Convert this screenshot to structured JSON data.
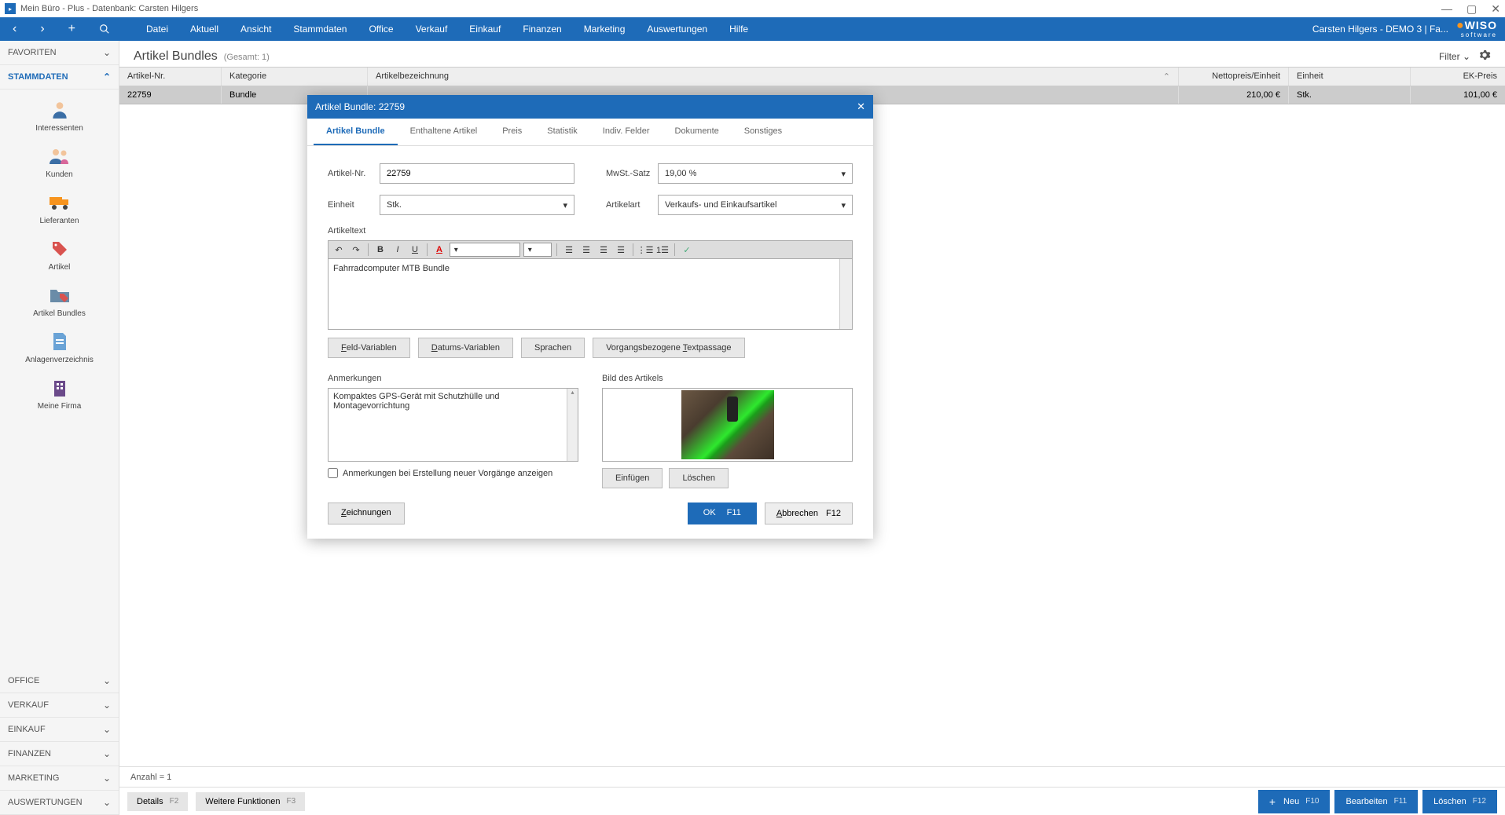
{
  "titlebar": {
    "text": "Mein Büro - Plus - Datenbank: Carsten Hilgers"
  },
  "toolbar": {
    "menu": [
      "Datei",
      "Aktuell",
      "Ansicht",
      "Stammdaten",
      "Office",
      "Verkauf",
      "Einkauf",
      "Finanzen",
      "Marketing",
      "Auswertungen",
      "Hilfe"
    ],
    "user": "Carsten Hilgers - DEMO 3 | Fa...",
    "brand": "WISO",
    "brand_sub": "software"
  },
  "sidebar": {
    "favoriten": "FAVORITEN",
    "stammdaten": "STAMMDATEN",
    "items": [
      {
        "label": "Interessenten"
      },
      {
        "label": "Kunden"
      },
      {
        "label": "Lieferanten"
      },
      {
        "label": "Artikel"
      },
      {
        "label": "Artikel Bundles"
      },
      {
        "label": "Anlagenverzeichnis"
      },
      {
        "label": "Meine Firma"
      }
    ],
    "bottom": [
      "OFFICE",
      "VERKAUF",
      "EINKAUF",
      "FINANZEN",
      "MARKETING",
      "AUSWERTUNGEN"
    ]
  },
  "content": {
    "title": "Artikel Bundles",
    "count": "(Gesamt: 1)",
    "filter": "Filter",
    "columns": {
      "artnr": "Artikel-Nr.",
      "kat": "Kategorie",
      "bez": "Artikelbezeichnung",
      "preis": "Nettopreis/Einheit",
      "einh": "Einheit",
      "ek": "EK-Preis"
    },
    "row": {
      "artnr": "22759",
      "kat": "Bundle",
      "preis": "210,00 €",
      "einh": "Stk.",
      "ek": "101,00 €"
    },
    "status": "Anzahl = 1",
    "details": "Details",
    "details_key": "F2",
    "weitere": "Weitere Funktionen",
    "weitere_key": "F3",
    "neu": "Neu",
    "neu_key": "F10",
    "bearbeiten": "Bearbeiten",
    "bearbeiten_key": "F11",
    "loeschen": "Löschen",
    "loeschen_key": "F12"
  },
  "modal": {
    "title": "Artikel Bundle: 22759",
    "tabs": [
      "Artikel Bundle",
      "Enthaltene Artikel",
      "Preis",
      "Statistik",
      "Indiv. Felder",
      "Dokumente",
      "Sonstiges"
    ],
    "artikel_nr_label": "Artikel-Nr.",
    "artikel_nr": "22759",
    "mwst_label": "MwSt.-Satz",
    "mwst": "19,00 %",
    "einheit_label": "Einheit",
    "einheit": "Stk.",
    "artikelart_label": "Artikelart",
    "artikelart": "Verkaufs- und Einkaufsartikel",
    "artikeltext_label": "Artikeltext",
    "artikeltext": "Fahrradcomputer MTB Bundle",
    "feld_var": "Feld-Variablen",
    "datums_var": "Datums-Variablen",
    "sprachen": "Sprachen",
    "vorgang": "Vorgangsbezogene Textpassage",
    "anmerkungen_label": "Anmerkungen",
    "anmerkungen": "Kompaktes GPS-Gerät mit Schutzhülle und Montagevorrichtung",
    "bild_label": "Bild des Artikels",
    "checkbox": "Anmerkungen bei Erstellung neuer Vorgänge anzeigen",
    "einfuegen": "Einfügen",
    "loeschen": "Löschen",
    "zeichnungen": "Zeichnungen",
    "ok": "OK",
    "ok_key": "F11",
    "abbrechen": "Abbrechen",
    "abbrechen_key": "F12"
  }
}
